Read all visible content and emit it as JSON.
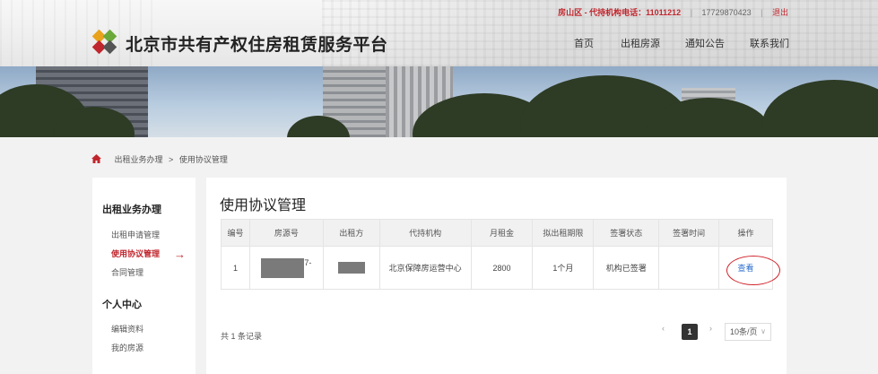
{
  "topbar": {
    "hotline": "房山区 - 代持机构电话：11011212",
    "phone": "17729870423",
    "logout": "退出"
  },
  "site": {
    "title": "北京市共有产权住房租赁服务平台"
  },
  "nav": [
    "首页",
    "出租房源",
    "通知公告",
    "联系我们"
  ],
  "breadcrumb": {
    "items": [
      "出租业务办理",
      "使用协议管理"
    ],
    "separator": ">"
  },
  "sidebar": {
    "sections": [
      {
        "heading": "出租业务办理",
        "items": [
          "出租申请管理",
          "使用协议管理",
          "合同管理"
        ],
        "active": "使用协议管理"
      },
      {
        "heading": "个人中心",
        "items": [
          "编辑资料",
          "我的房源"
        ]
      }
    ]
  },
  "main": {
    "title": "使用协议管理",
    "table": {
      "headers": [
        "编号",
        "房源号",
        "出租方",
        "代持机构",
        "月租金",
        "拟出租期限",
        "签署状态",
        "签署时间",
        "操作"
      ],
      "rows": [
        {
          "no": "1",
          "house_suffix": "7-",
          "agency": "北京保障房运营中心",
          "rent": "2800",
          "term": "1个月",
          "status": "机构已签署",
          "time": "",
          "action": "查看"
        }
      ]
    },
    "total": "共 1 条记录",
    "pagination": {
      "prev": "‹",
      "current": "1",
      "next": "›",
      "per_page": "10条/页",
      "caret": "∨"
    }
  },
  "colors": {
    "accent_red": "#c0262d",
    "link_blue": "#2a6ccc"
  },
  "icons": [
    "home-icon",
    "arrow-right-icon",
    "logo-icon",
    "chevron-left-icon",
    "chevron-right-icon",
    "chevron-down-icon"
  ]
}
